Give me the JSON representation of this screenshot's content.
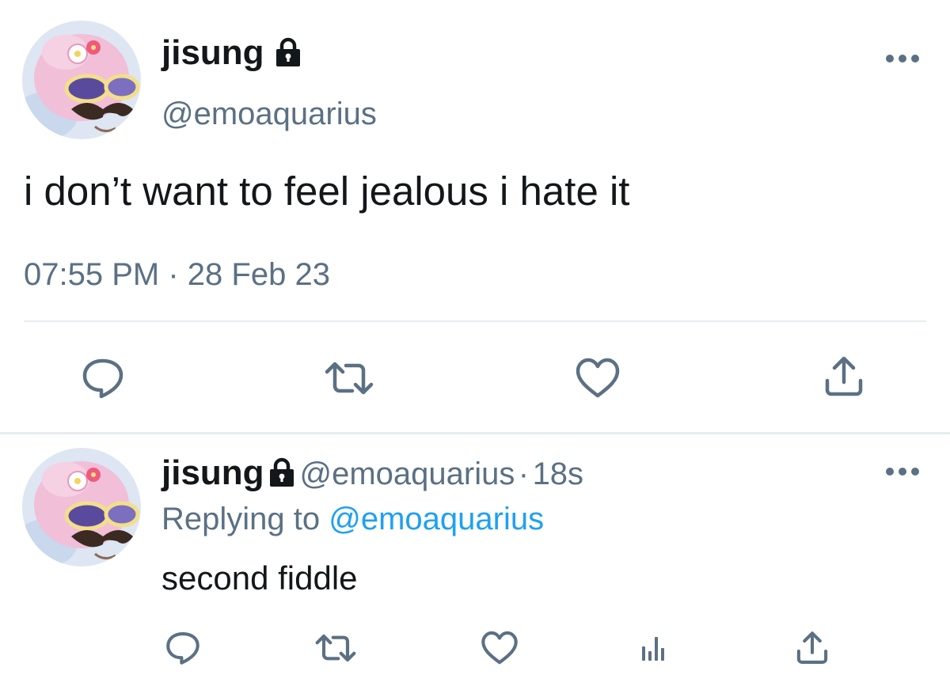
{
  "tweet": {
    "author_name": "jisung",
    "author_handle": "@emoaquarius",
    "text": "i don’t want to feel jealous i hate it",
    "time": "07:55 PM",
    "separator": "·",
    "date": "28 Feb 23",
    "actions": [
      "reply-icon",
      "retweet-icon",
      "like-icon",
      "share-icon"
    ]
  },
  "reply": {
    "author_name": "jisung",
    "author_handle": "@emoaquarius",
    "separator": "·",
    "age": "18s",
    "replying_label": "Replying to",
    "replying_to": "@emoaquarius",
    "text": "second fiddle",
    "actions": [
      "reply-icon",
      "retweet-icon",
      "like-icon",
      "analytics-icon",
      "share-icon"
    ]
  },
  "colors": {
    "text_primary": "#14171a",
    "text_secondary": "#5b7083",
    "link": "#1da1f2",
    "icon": "#5b7083",
    "divider": "#e6ecf0",
    "avatar_bg": "#dde6f2",
    "avatar_character": "#f1bfd8"
  }
}
